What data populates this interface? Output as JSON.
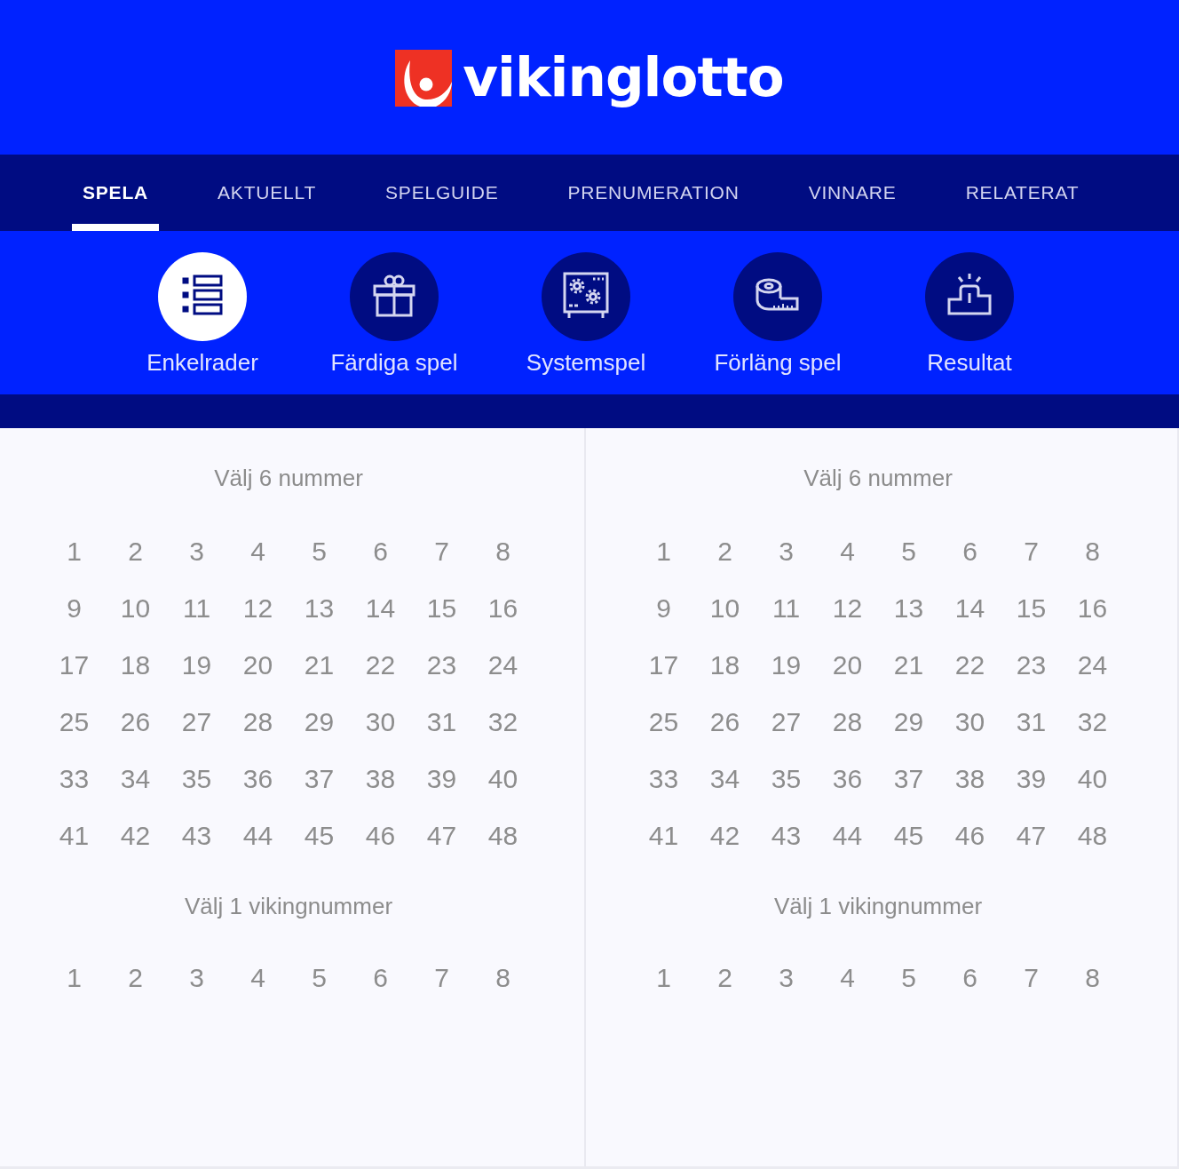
{
  "header": {
    "logo_text": "vikinglotto"
  },
  "nav": {
    "tabs": [
      {
        "label": "SPELA",
        "selected": true
      },
      {
        "label": "AKTUELLT",
        "selected": false
      },
      {
        "label": "SPELGUIDE",
        "selected": false
      },
      {
        "label": "PRENUMERATION",
        "selected": false
      },
      {
        "label": "VINNARE",
        "selected": false
      },
      {
        "label": "RELATERAT",
        "selected": false
      }
    ]
  },
  "game_types": [
    {
      "label": "Enkelrader",
      "selected": true
    },
    {
      "label": "Färdiga spel",
      "selected": false
    },
    {
      "label": "Systemspel",
      "selected": false
    },
    {
      "label": "Förläng spel",
      "selected": false
    },
    {
      "label": "Resultat",
      "selected": false
    }
  ],
  "coupons": [
    {
      "main_heading": "Välj 6 nummer",
      "main_numbers": [
        "1",
        "2",
        "3",
        "4",
        "5",
        "6",
        "7",
        "8",
        "9",
        "10",
        "11",
        "12",
        "13",
        "14",
        "15",
        "16",
        "17",
        "18",
        "19",
        "20",
        "21",
        "22",
        "23",
        "24",
        "25",
        "26",
        "27",
        "28",
        "29",
        "30",
        "31",
        "32",
        "33",
        "34",
        "35",
        "36",
        "37",
        "38",
        "39",
        "40",
        "41",
        "42",
        "43",
        "44",
        "45",
        "46",
        "47",
        "48"
      ],
      "viking_heading": "Välj 1 vikingnummer",
      "viking_numbers": [
        "1",
        "2",
        "3",
        "4",
        "5",
        "6",
        "7",
        "8"
      ]
    },
    {
      "main_heading": "Välj 6 nummer",
      "main_numbers": [
        "1",
        "2",
        "3",
        "4",
        "5",
        "6",
        "7",
        "8",
        "9",
        "10",
        "11",
        "12",
        "13",
        "14",
        "15",
        "16",
        "17",
        "18",
        "19",
        "20",
        "21",
        "22",
        "23",
        "24",
        "25",
        "26",
        "27",
        "28",
        "29",
        "30",
        "31",
        "32",
        "33",
        "34",
        "35",
        "36",
        "37",
        "38",
        "39",
        "40",
        "41",
        "42",
        "43",
        "44",
        "45",
        "46",
        "47",
        "48"
      ],
      "viking_heading": "Välj 1 vikingnummer",
      "viking_numbers": [
        "1",
        "2",
        "3",
        "4",
        "5",
        "6",
        "7",
        "8"
      ]
    }
  ]
}
